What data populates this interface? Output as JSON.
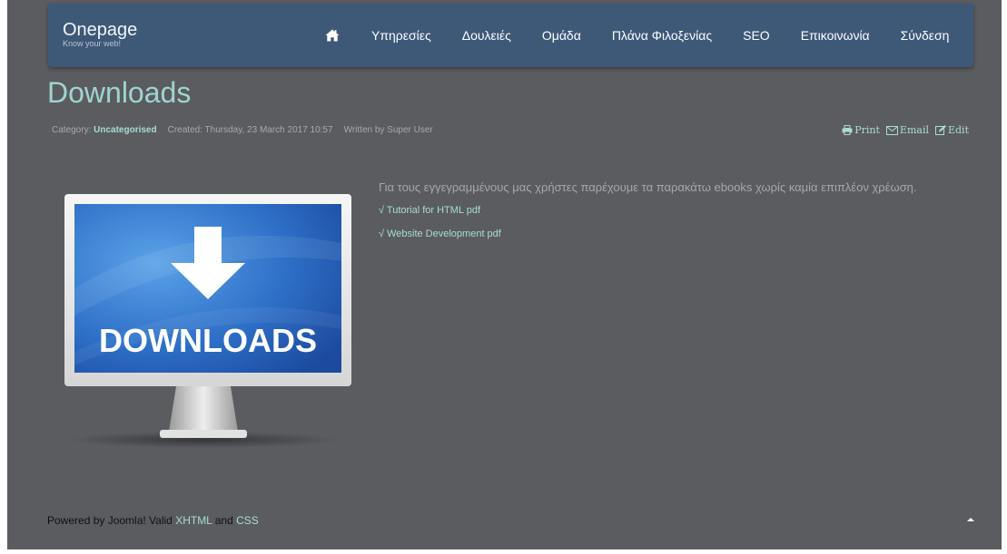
{
  "brand": {
    "name": "Onepage",
    "tagline": "Know your web!"
  },
  "nav": {
    "home_icon": "home-icon",
    "items": [
      "Υπηρεσίες",
      "Δουλειές",
      "Ομάδα",
      "Πλάνα Φιλοξενίας",
      "SEO",
      "Επικοινωνία",
      "Σύνδεση"
    ]
  },
  "article": {
    "title": "Downloads",
    "meta": {
      "category_label": "Category:",
      "category_value": "Uncategorised",
      "created": "Created: Thursday, 23 March 2017 10:57",
      "author": "Written by Super User"
    },
    "actions": [
      "Print",
      "Email",
      "Edit"
    ],
    "image_text": "DOWNLOADS",
    "intro": "Για τους εγγεγραμμένους μας χρήστες παρέχουμε τα παρακάτω ebooks χωρίς καμία επιπλέον χρέωση.",
    "links": [
      "√ Tutorial for HTML pdf",
      "√ Website Development pdf"
    ]
  },
  "footer": {
    "prefix": "Powered by Joomla! Valid ",
    "link1": "XHTML",
    "middle": " and ",
    "link2": "CSS"
  },
  "colors": {
    "background": "#5b5c60",
    "navbar": "#3e5878",
    "accent": "#a8dcd5",
    "title": "#9fd4cf"
  }
}
